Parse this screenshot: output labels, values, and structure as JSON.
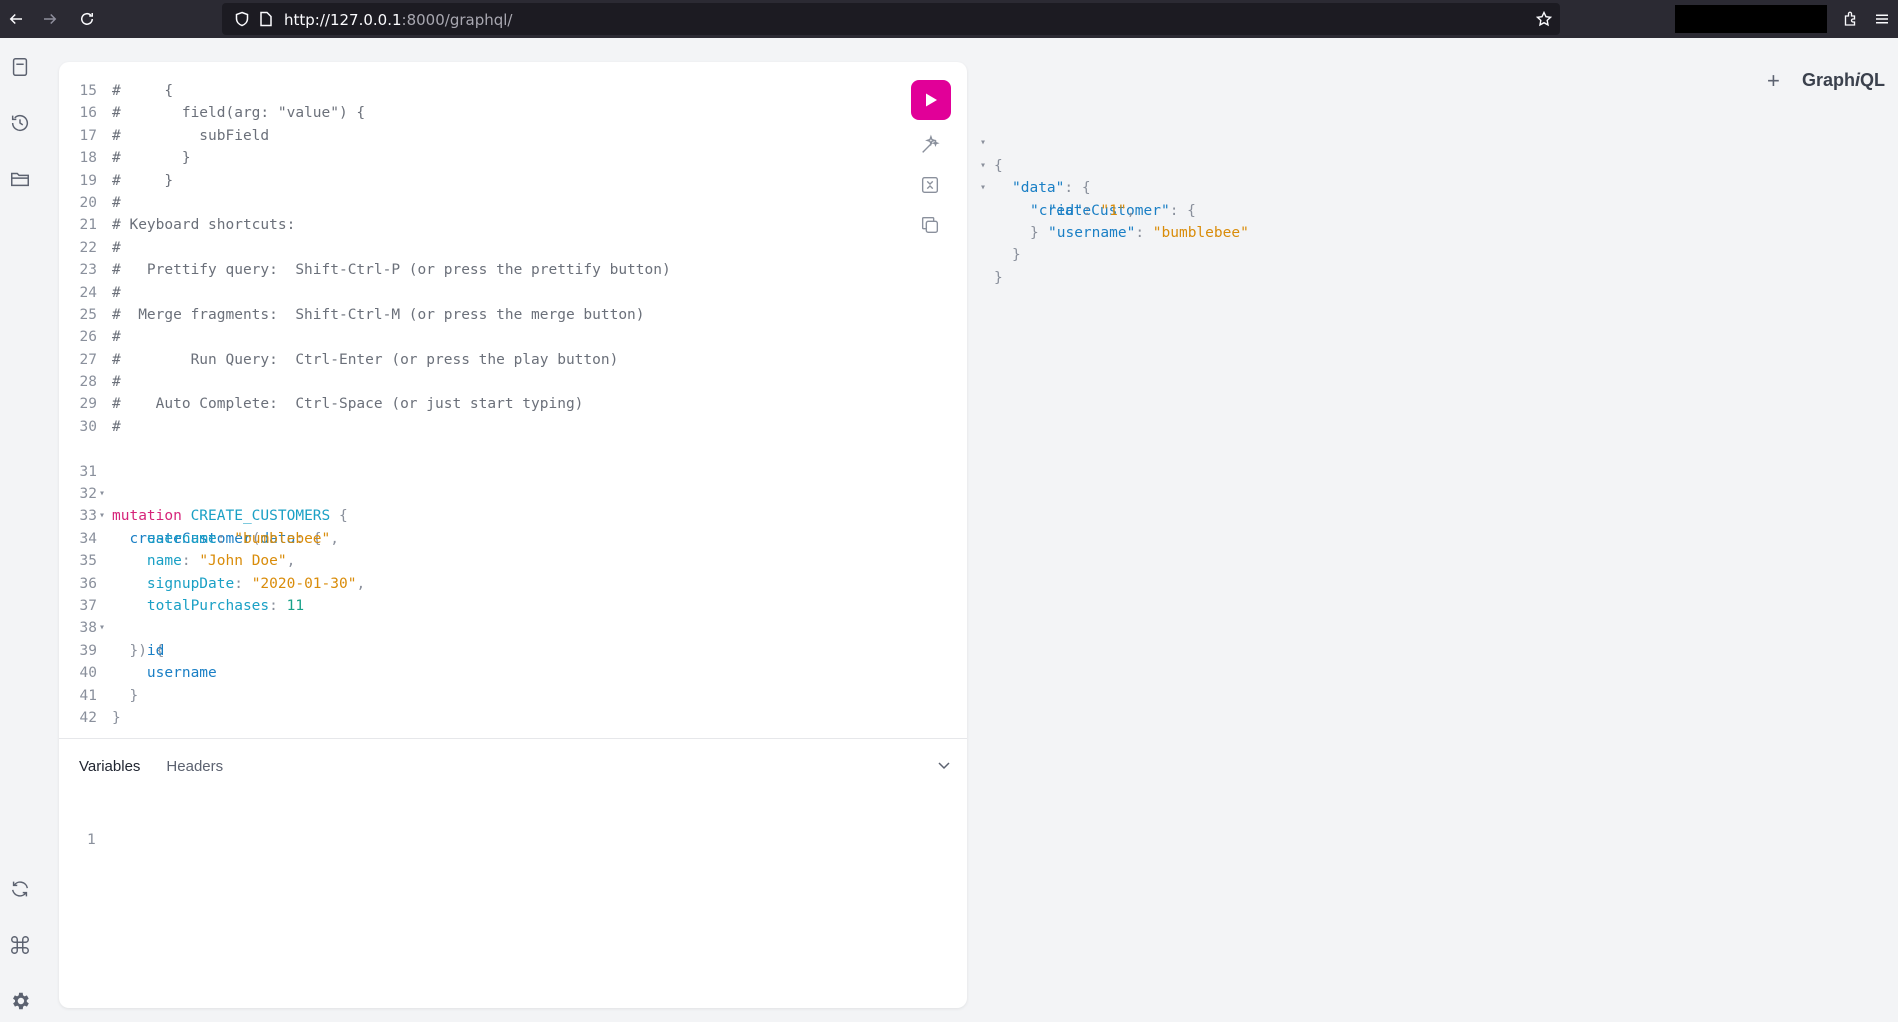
{
  "browser": {
    "url_host": "http://127.0.0.1",
    "url_rest": ":8000/graphql/"
  },
  "editor": {
    "lines": [
      {
        "n": "15",
        "html": "#     {"
      },
      {
        "n": "16",
        "html": "#       field(arg: \"value\") {"
      },
      {
        "n": "17",
        "html": "#         subField"
      },
      {
        "n": "18",
        "html": "#       }"
      },
      {
        "n": "19",
        "html": "#     }"
      },
      {
        "n": "20",
        "html": "#"
      },
      {
        "n": "21",
        "html": "# Keyboard shortcuts:"
      },
      {
        "n": "22",
        "html": "#"
      },
      {
        "n": "23",
        "html": "#   Prettify query:  Shift-Ctrl-P (or press the prettify button)"
      },
      {
        "n": "24",
        "html": "#"
      },
      {
        "n": "25",
        "html": "#  Merge fragments:  Shift-Ctrl-M (or press the merge button)"
      },
      {
        "n": "26",
        "html": "#"
      },
      {
        "n": "27",
        "html": "#        Run Query:  Ctrl-Enter (or press the play button)"
      },
      {
        "n": "28",
        "html": "#"
      },
      {
        "n": "29",
        "html": "#    Auto Complete:  Ctrl-Space (or just start typing)"
      },
      {
        "n": "30",
        "html": "#"
      }
    ],
    "mutation": {
      "n31": "31",
      "keyword": "mutation",
      "name": "CREATE_CUSTOMERS",
      "n32": "32",
      "field": "createCustomer",
      "arg": "data",
      "n33": "33",
      "k33": "username",
      "v33": "\"bumblebee\"",
      "n34": "34",
      "k34": "name",
      "v34": "\"John Doe\"",
      "n35": "35",
      "k35": "signupDate",
      "v35": "\"2020-01-30\"",
      "n36": "36",
      "k36": "totalPurchases",
      "v36": "11",
      "n37": "37",
      "n38": "38",
      "f38": "id",
      "n39": "39",
      "f39": "username",
      "n40": "40",
      "n41": "41",
      "n42": "42"
    },
    "tabs": {
      "variables": "Variables",
      "headers": "Headers"
    },
    "variables_line": "1"
  },
  "result": {
    "brand_prefix": "Graph",
    "brand_italic": "i",
    "brand_suffix": "QL",
    "data_key": "\"data\"",
    "create_key": "\"createCustomer\"",
    "id_key": "\"id\"",
    "id_val": "\"1\"",
    "user_key": "\"username\"",
    "user_val": "\"bumblebee\""
  }
}
